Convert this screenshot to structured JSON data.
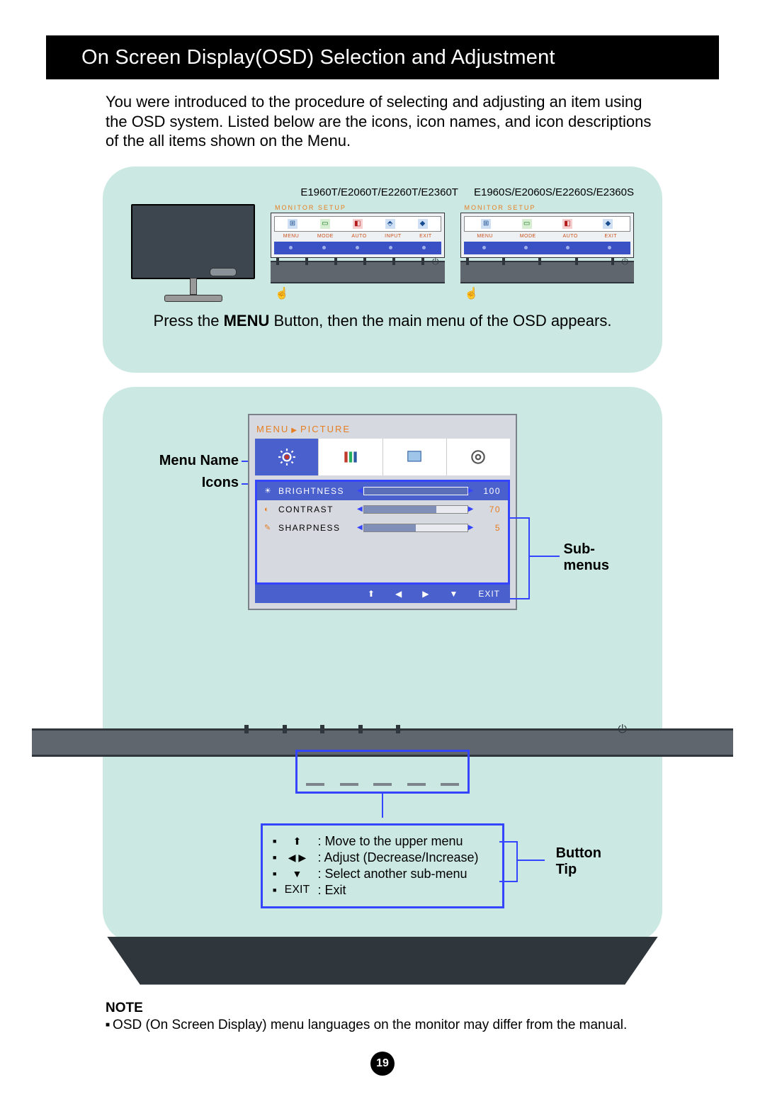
{
  "title": "On Screen Display(OSD) Selection and Adjustment",
  "intro": "You were introduced to the procedure of selecting and adjusting an item using the OSD system. Listed below are the icons, icon names, and icon descriptions of the all items shown on the Menu.",
  "models": {
    "t": "E1960T/E2060T/E2260T/E2360T",
    "s": "E1960S/E2060S/E2260S/E2360S"
  },
  "mini_setup_title": "MONITOR SETUP",
  "mini_labels_t": [
    "MENU",
    "MODE",
    "AUTO",
    "INPUT",
    "EXIT"
  ],
  "mini_labels_s": [
    "MENU",
    "MODE",
    "AUTO",
    "EXIT"
  ],
  "caption_pre": "Press the ",
  "caption_bold": "MENU",
  "caption_post": " Button, then the main menu of the OSD appears.",
  "labels": {
    "menu_name": "Menu Name",
    "icons": "Icons",
    "submenus": "Sub-\nmenus",
    "button_tip": "Button\nTip"
  },
  "osd": {
    "breadcrumb_menu": "MENU",
    "breadcrumb_page": "PICTURE",
    "items": [
      {
        "icon": "brightness",
        "name": "BRIGHTNESS",
        "value": 100,
        "fill": 100
      },
      {
        "icon": "contrast",
        "name": "CONTRAST",
        "value": 70,
        "fill": 70
      },
      {
        "icon": "sharpness",
        "name": "SHARPNESS",
        "value": 5,
        "fill": 50
      }
    ],
    "footer_exit": "EXIT"
  },
  "tips": {
    "up": ": Move to the upper menu",
    "lr": ": Adjust (Decrease/Increase)",
    "down": ": Select another sub-menu",
    "exit_label": "EXIT",
    "exit": ": Exit"
  },
  "note": {
    "h": "NOTE",
    "t": "OSD (On Screen Display) menu languages on the monitor may differ from the manual."
  },
  "page_number": "19"
}
